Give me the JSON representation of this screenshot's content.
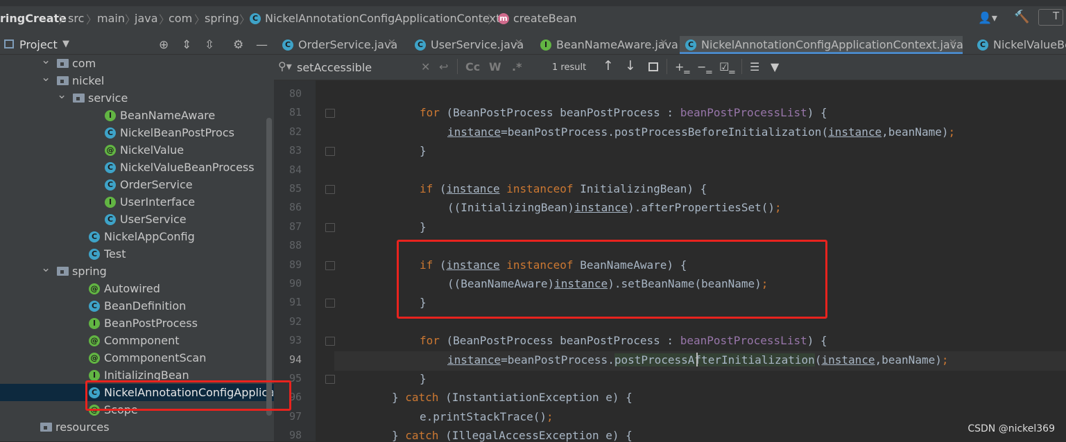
{
  "breadcrumb": {
    "items": [
      "ringCreate",
      "src",
      "main",
      "java",
      "com",
      "spring",
      "NickelAnnotationConfigApplicationContext",
      "createBean"
    ],
    "right_text": "T"
  },
  "project": {
    "title": "Project",
    "tree": [
      {
        "label": "com",
        "icon": "folder-icon",
        "arrow": "expanded"
      },
      {
        "label": "nickel",
        "icon": "folder-icon",
        "arrow": "expanded"
      },
      {
        "label": "service",
        "icon": "folder-icon",
        "arrow": "expanded"
      },
      {
        "label": "BeanNameAware",
        "icon": "I"
      },
      {
        "label": "NickelBeanPostProcs",
        "icon": "C"
      },
      {
        "label": "NickelValue",
        "icon": "@"
      },
      {
        "label": "NickelValueBeanProcess",
        "icon": "C"
      },
      {
        "label": "OrderService",
        "icon": "C"
      },
      {
        "label": "UserInterface",
        "icon": "I"
      },
      {
        "label": "UserService",
        "icon": "C"
      },
      {
        "label": "NickelAppConfig",
        "icon": "C"
      },
      {
        "label": "Test",
        "icon": "C"
      },
      {
        "label": "spring",
        "icon": "folder-icon",
        "arrow": "expanded"
      },
      {
        "label": "Autowired",
        "icon": "@"
      },
      {
        "label": "BeanDefinition",
        "icon": "C"
      },
      {
        "label": "BeanPostProcess",
        "icon": "I"
      },
      {
        "label": "Commponent",
        "icon": "@"
      },
      {
        "label": "CommponentScan",
        "icon": "@"
      },
      {
        "label": "InitializingBean",
        "icon": "I"
      },
      {
        "label": "NickelAnnotationConfigApplicatio",
        "icon": "C",
        "selected": true
      },
      {
        "label": "Scope",
        "icon": "@"
      },
      {
        "label": "resources",
        "icon": "folder-icon"
      }
    ]
  },
  "tabs": [
    {
      "label": "OrderService.java",
      "icon": "C"
    },
    {
      "label": "UserService.java",
      "icon": "C"
    },
    {
      "label": "BeanNameAware.java",
      "icon": "I"
    },
    {
      "label": "NickelAnnotationConfigApplicationContext.java",
      "icon": "C",
      "active": true
    },
    {
      "label": "NickelValueBe",
      "icon": "C"
    }
  ],
  "find": {
    "query": "setAccessible",
    "result_count": "1 result",
    "case_label": "Cc",
    "word_label": "W",
    "regex_label": ".*"
  },
  "editor": {
    "line_numbers": [
      "80",
      "81",
      "82",
      "83",
      "84",
      "85",
      "86",
      "87",
      "88",
      "89",
      "90",
      "91",
      "92",
      "93",
      "94",
      "95",
      "96",
      "97",
      "98"
    ],
    "current_line": "94",
    "code_lines": [
      [],
      [
        [
          "for",
          "kw"
        ],
        [
          " (BeanPostProcess beanPostProcess : ",
          ""
        ],
        [
          "beanPostProcessList",
          "fld"
        ],
        [
          ") {",
          ""
        ]
      ],
      [
        [
          "instance",
          "und"
        ],
        [
          "=beanPostProcess.postProcessBeforeInitialization(",
          ""
        ],
        [
          "instance",
          "und"
        ],
        [
          ",beanName)",
          ""
        ],
        [
          ";",
          "kw"
        ]
      ],
      [
        [
          "}",
          ""
        ]
      ],
      [],
      [
        [
          "if",
          "kw"
        ],
        [
          " (",
          ""
        ],
        [
          "instance",
          "und"
        ],
        [
          " ",
          ""
        ],
        [
          "instanceof",
          "kw"
        ],
        [
          " InitializingBean) {",
          ""
        ]
      ],
      [
        [
          "((InitializingBean)",
          ""
        ],
        [
          "instance",
          "und"
        ],
        [
          ").afterPropertiesSet()",
          ""
        ],
        [
          ";",
          "kw"
        ]
      ],
      [
        [
          "}",
          ""
        ]
      ],
      [],
      [
        [
          "if",
          "kw"
        ],
        [
          " (",
          ""
        ],
        [
          "instance",
          "und"
        ],
        [
          " ",
          ""
        ],
        [
          "instanceof",
          "kw"
        ],
        [
          " BeanNameAware) {",
          ""
        ]
      ],
      [
        [
          "((BeanNameAware)",
          ""
        ],
        [
          "instance",
          "und"
        ],
        [
          ").setBeanName(beanName)",
          ""
        ],
        [
          ";",
          "kw"
        ]
      ],
      [
        [
          "}",
          ""
        ]
      ],
      [],
      [
        [
          "for",
          "kw"
        ],
        [
          " (BeanPostProcess beanPostProcess : ",
          ""
        ],
        [
          "beanPostProcessList",
          "fld"
        ],
        [
          ") {",
          ""
        ]
      ],
      [
        [
          "instance",
          "und"
        ],
        [
          "=beanPostProcess.",
          ""
        ],
        [
          "postProcessAfterInitialization",
          "hlw"
        ],
        [
          "(",
          ""
        ],
        [
          "instance",
          "und"
        ],
        [
          ",beanName)",
          ""
        ],
        [
          ";",
          "kw"
        ]
      ],
      [
        [
          "}",
          ""
        ]
      ],
      [
        [
          "} ",
          ""
        ],
        [
          "catch",
          "kw"
        ],
        [
          " (InstantiationException e) {",
          ""
        ]
      ],
      [
        [
          "e.printStackTrace()",
          ""
        ],
        [
          ";",
          "kw"
        ]
      ],
      [
        [
          "} ",
          ""
        ],
        [
          "catch",
          "kw"
        ],
        [
          " (IllegalAccessException e) {",
          ""
        ]
      ]
    ]
  },
  "watermark": "CSDN @nickel369",
  "colors": {
    "highlight_box": "#e8231e",
    "accent": "#4a88c7"
  }
}
